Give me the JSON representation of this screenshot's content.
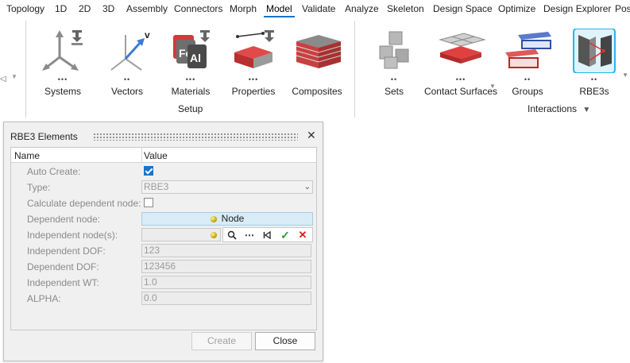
{
  "menu": [
    "Topology",
    "1D",
    "2D",
    "3D",
    "Assembly",
    "Connectors",
    "Morph",
    "Model",
    "Validate",
    "Analyze",
    "Skeleton",
    "Design Space",
    "Optimize",
    "Design Explorer",
    "Post"
  ],
  "menu_active": "Model",
  "ribbon": {
    "tools": [
      {
        "label": "Systems",
        "dots": "•••"
      },
      {
        "label": "Vectors",
        "dots": "••"
      },
      {
        "label": "Materials",
        "dots": "•••"
      },
      {
        "label": "Properties",
        "dots": "•••"
      },
      {
        "label": "Composites",
        "dots": ""
      },
      {
        "label": "Sets",
        "dots": "••"
      },
      {
        "label": "Contact Surfaces",
        "dots": "•••"
      },
      {
        "label": "Groups",
        "dots": "••"
      },
      {
        "label": "RBE3s",
        "dots": "••"
      }
    ],
    "groups": {
      "setup": "Setup",
      "interactions": "Interactions"
    },
    "vectors_badge": "v",
    "materials_badge_fe": "Fe",
    "materials_badge_al": "Al"
  },
  "dialog": {
    "title": "RBE3 Elements",
    "columns": {
      "name": "Name",
      "value": "Value"
    },
    "rows": {
      "auto_create": {
        "label": "Auto Create:",
        "checked": true
      },
      "type": {
        "label": "Type:",
        "value": "RBE3"
      },
      "calc_dep": {
        "label": "Calculate dependent node:",
        "checked": false
      },
      "dep_node": {
        "label": "Dependent node:",
        "value": "Node"
      },
      "indep_nodes": {
        "label": "Independent node(s):"
      },
      "indep_dof": {
        "label": "Independent DOF:",
        "value": "123"
      },
      "dep_dof": {
        "label": "Dependent DOF:",
        "value": "123456"
      },
      "indep_wt": {
        "label": "Independent WT:",
        "value": "1.0"
      },
      "alpha": {
        "label": "ALPHA:",
        "value": "0.0"
      }
    },
    "buttons": {
      "create": "Create",
      "close": "Close"
    }
  },
  "icons": {
    "dialog_close": "close-icon",
    "search": "search-icon",
    "more": "more-icon",
    "reset": "reset-icon",
    "confirm": "check-icon",
    "cancel": "x-icon"
  },
  "colors": {
    "accent": "#1a73c8",
    "node_highlight": "#d8ecf7",
    "confirm": "#2e9e2e",
    "cancel": "#d42020"
  }
}
